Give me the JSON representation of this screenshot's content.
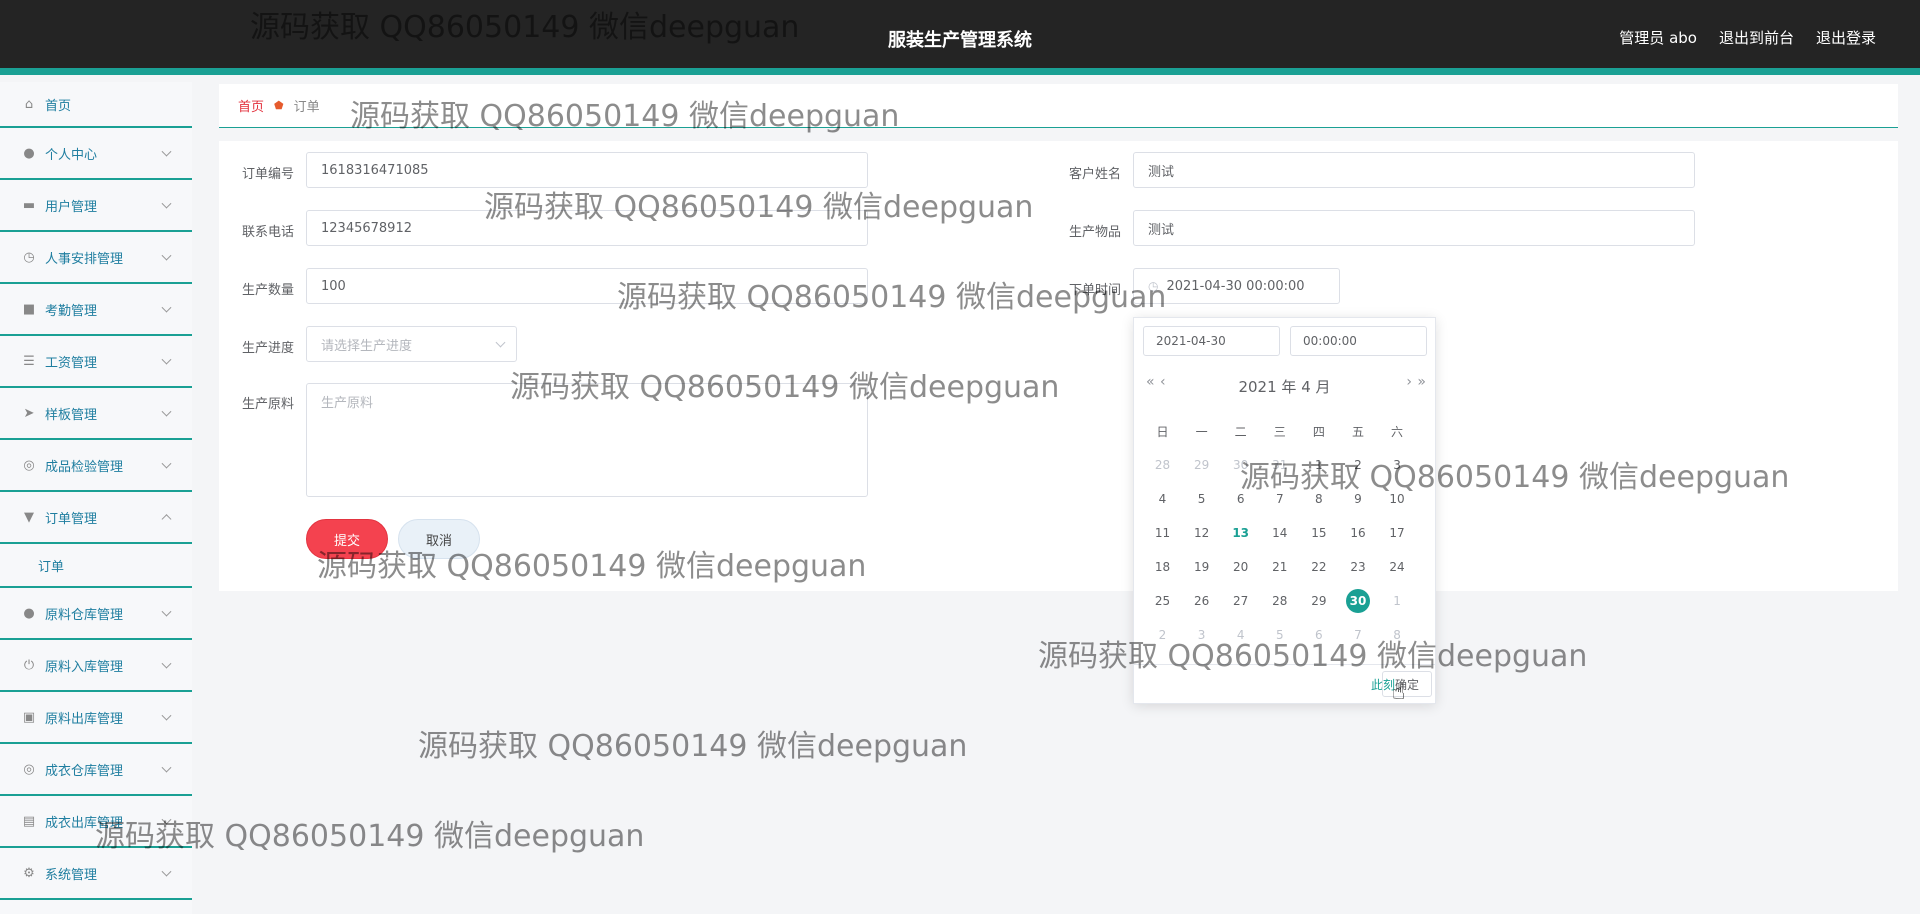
{
  "header": {
    "app_title": "服装生产管理系统",
    "user_label": "管理员 abo",
    "front_label": "退出到前台",
    "logout_label": "退出登录"
  },
  "sidebar": {
    "items": [
      {
        "label": "首页",
        "icon": "home-icon"
      },
      {
        "label": "个人中心",
        "icon": "user-icon"
      },
      {
        "label": "用户管理",
        "icon": "users-icon"
      },
      {
        "label": "人事安排管理",
        "icon": "clock-icon"
      },
      {
        "label": "考勤管理",
        "icon": "chat-icon"
      },
      {
        "label": "工资管理",
        "icon": "list-icon"
      },
      {
        "label": "样板管理",
        "icon": "send-icon"
      },
      {
        "label": "成品检验管理",
        "icon": "target-icon"
      },
      {
        "label": "订单管理",
        "icon": "bookmark-icon"
      },
      {
        "label": "订单",
        "icon": ""
      },
      {
        "label": "原料仓库管理",
        "icon": "user-icon"
      },
      {
        "label": "原料入库管理",
        "icon": "power-icon"
      },
      {
        "label": "原料出库管理",
        "icon": "box-icon"
      },
      {
        "label": "成衣仓库管理",
        "icon": "target-icon"
      },
      {
        "label": "成衣出库管理",
        "icon": "doc-icon"
      },
      {
        "label": "系统管理",
        "icon": "gear-icon"
      }
    ]
  },
  "breadcrumb": {
    "home": "首页",
    "current": "订单"
  },
  "form": {
    "order_no_label": "订单编号",
    "order_no": "1618316471085",
    "phone_label": "联系电话",
    "phone": "12345678912",
    "qty_label": "生产数量",
    "qty": "100",
    "progress_label": "生产进度",
    "progress_placeholder": "请选择生产进度",
    "material_label": "生产原料",
    "material_placeholder": "生产原料",
    "customer_label": "客户姓名",
    "customer": "测试",
    "item_label": "生产物品",
    "item": "测试",
    "time_label": "下单时间",
    "time": "2021-04-30 00:00:00",
    "submit_label": "提交",
    "cancel_label": "取消"
  },
  "picker": {
    "date": "2021-04-30",
    "time": "00:00:00",
    "year_label": "2021 年",
    "month_label": "4 月",
    "weekdays": [
      "日",
      "一",
      "二",
      "三",
      "四",
      "五",
      "六"
    ],
    "weeks": [
      [
        "28",
        "29",
        "30",
        "31",
        "1",
        "2",
        "3"
      ],
      [
        "4",
        "5",
        "6",
        "7",
        "8",
        "9",
        "10"
      ],
      [
        "11",
        "12",
        "13",
        "14",
        "15",
        "16",
        "17"
      ],
      [
        "18",
        "19",
        "20",
        "21",
        "22",
        "23",
        "24"
      ],
      [
        "25",
        "26",
        "27",
        "28",
        "29",
        "30",
        "1"
      ],
      [
        "2",
        "3",
        "4",
        "5",
        "6",
        "7",
        "8"
      ]
    ],
    "now_label": "此刻",
    "ok_label": "确定",
    "accent": "#1aa094"
  },
  "watermark": "源码获取 QQ86050149 微信deepguan"
}
